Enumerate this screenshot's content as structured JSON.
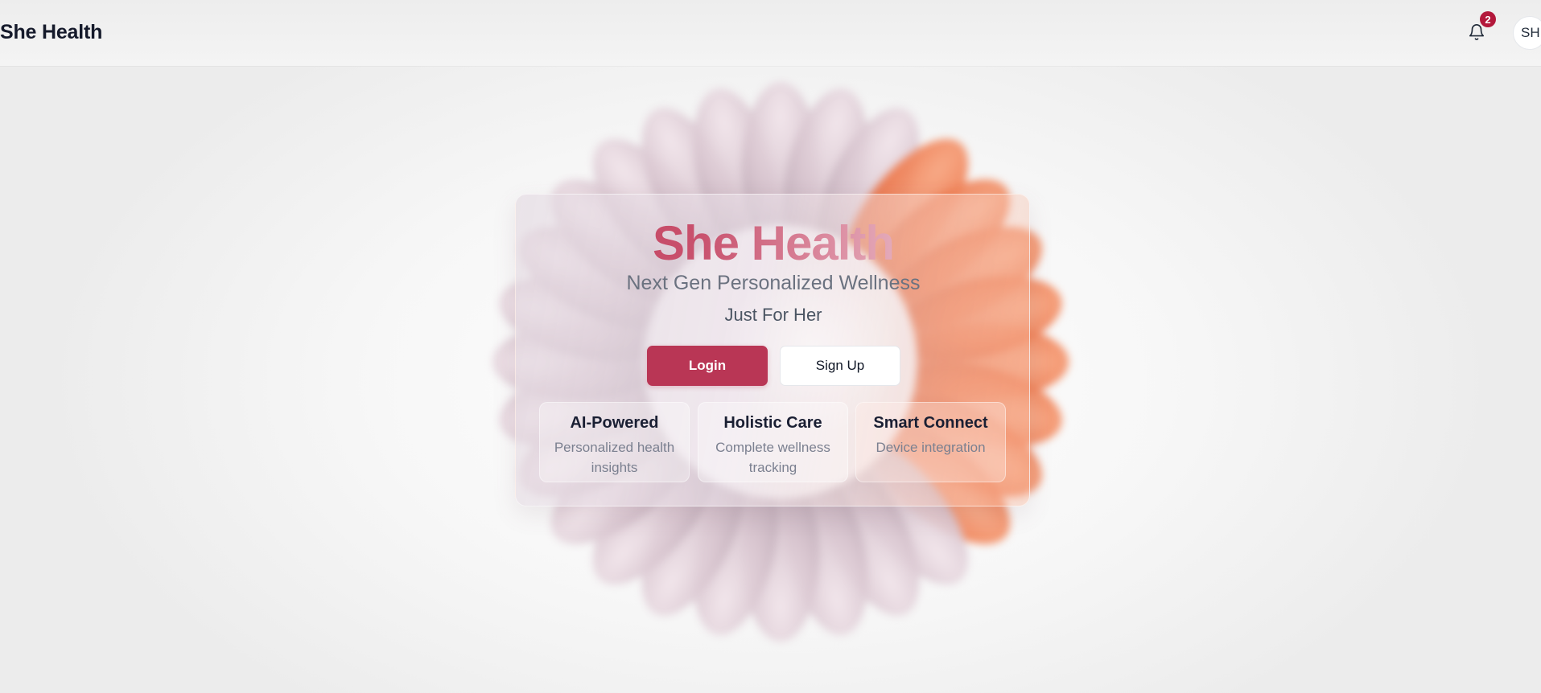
{
  "header": {
    "brand": "She Health",
    "notification_count": "2",
    "avatar_initials": "SH"
  },
  "hero": {
    "title": "She Health",
    "subtitle": "Next Gen Personalized Wellness",
    "tagline": "Just For Her",
    "login_label": "Login",
    "signup_label": "Sign Up"
  },
  "features": [
    {
      "title": "AI-Powered",
      "description": "Personalized health insights"
    },
    {
      "title": "Holistic Care",
      "description": "Complete wellness tracking"
    },
    {
      "title": "Smart Connect",
      "description": "Device integration"
    }
  ],
  "colors": {
    "accent": "#b93655",
    "badge": "#b3183b",
    "petal_light": "#d9c3cf",
    "petal_orange": "#ee7a4e"
  },
  "icons": {
    "notifications": "bell-icon"
  }
}
